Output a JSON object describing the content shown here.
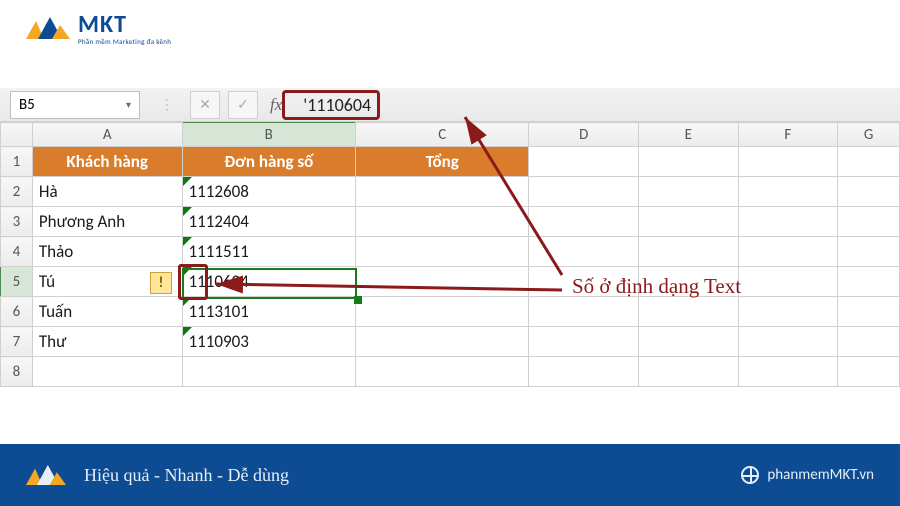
{
  "brand": {
    "name": "MKT",
    "subtitle": "Phần mềm Marketing đa kênh"
  },
  "name_box": "B5",
  "fx_value": "'1110604",
  "columns": [
    "A",
    "B",
    "C",
    "D",
    "E",
    "F",
    "G"
  ],
  "headers": {
    "A": "Khách hàng",
    "B": "Đơn hàng số",
    "C": "Tổng"
  },
  "rows": [
    {
      "n": 2,
      "A": "Hà",
      "B": "1112608"
    },
    {
      "n": 3,
      "A": "Phương Anh",
      "B": "1112404"
    },
    {
      "n": 4,
      "A": "Thảo",
      "B": "1111511"
    },
    {
      "n": 5,
      "A": "Tú",
      "B": "1110604"
    },
    {
      "n": 6,
      "A": "Tuấn",
      "B": "1113101"
    },
    {
      "n": 7,
      "A": "Thư",
      "B": "1110903"
    }
  ],
  "extra_row": 8,
  "active_cell": {
    "col": "B",
    "row": 5
  },
  "annotation": "Số ở định dạng Text",
  "footer": {
    "slogan": "Hiệu quả - Nhanh  - Dễ dùng",
    "site": "phanmemMKT.vn"
  },
  "icons": {
    "warn": "!",
    "dropdown": "▾",
    "cancel": "✕",
    "accept": "✓",
    "fx": "fx"
  }
}
